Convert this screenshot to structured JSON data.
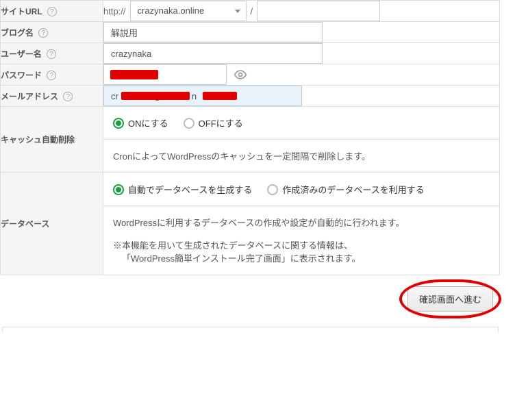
{
  "rows": {
    "siteUrl": {
      "label": "サイトURL",
      "protocol": "http://",
      "domain": "crazynaka.online",
      "path": ""
    },
    "blogName": {
      "label": "ブログ名",
      "value": "解説用"
    },
    "userName": {
      "label": "ユーザー名",
      "value": "crazynaka"
    },
    "password": {
      "label": "パスワード",
      "value": ""
    },
    "email": {
      "label": "メールアドレス",
      "value": "cr              @            n"
    },
    "cache": {
      "label": "キャッシュ自動削除",
      "on": "ONにする",
      "off": "OFFにする",
      "hint": "CronによってWordPressのキャッシュを一定間隔で削除します。"
    },
    "database": {
      "label": "データベース",
      "optAuto": "自動でデータベースを生成する",
      "optExisting": "作成済みのデータベースを利用する",
      "hintMain": "WordPressに利用するデータベースの作成や設定が自動的に行われます。",
      "hintSub1": "※本機能を用いて生成されたデータベースに関する情報は、",
      "hintSub2": "「WordPress簡単インストール完了画面」に表示されます。"
    }
  },
  "submit": "確認画面へ進む"
}
